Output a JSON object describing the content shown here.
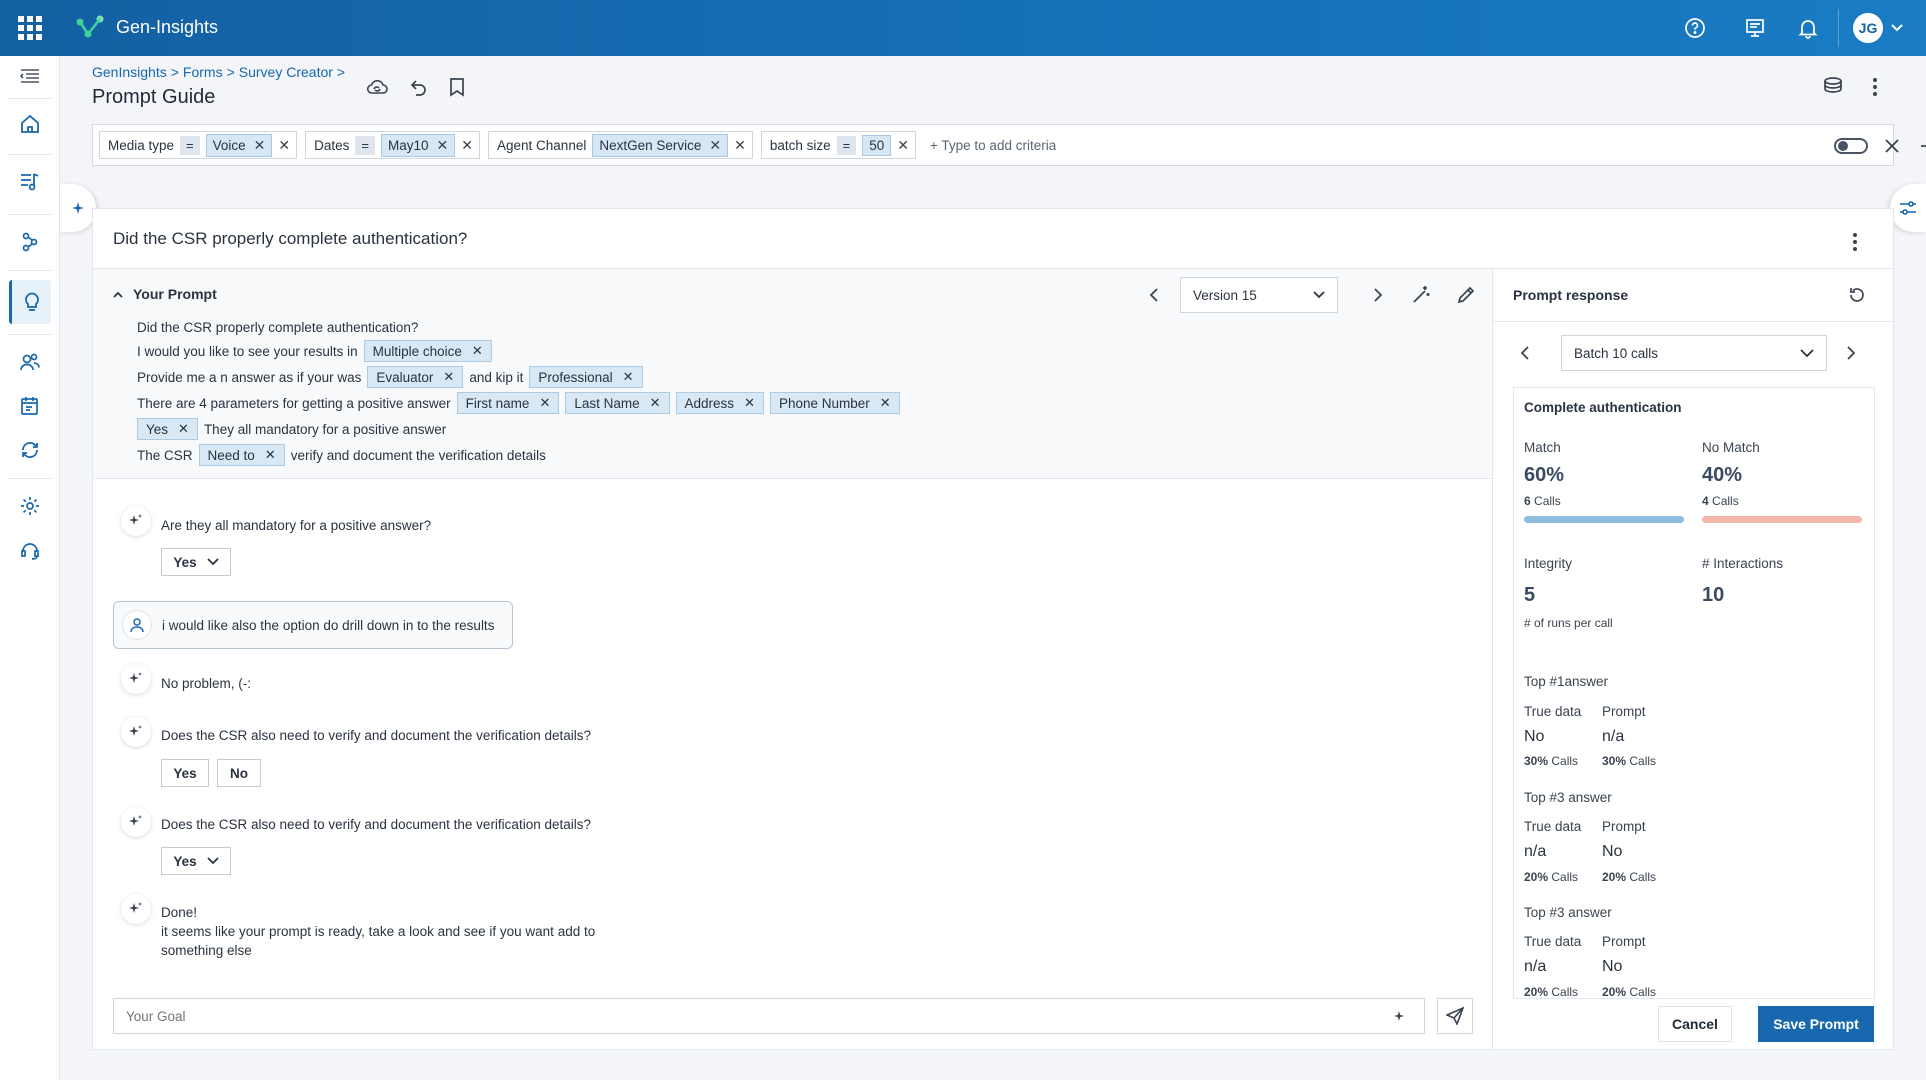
{
  "app": {
    "brand": "Gen-Insights",
    "avatar": "JG"
  },
  "breadcrumb": [
    "GenInsights",
    "Forms",
    "Survey Creator"
  ],
  "page_title": "Prompt Guide",
  "filters": [
    {
      "name": "Media type",
      "op": "=",
      "value": "Voice"
    },
    {
      "name": "Dates",
      "op": "=",
      "value": "May10"
    },
    {
      "name": "Agent Channel",
      "op": "",
      "value": "NextGen Service"
    },
    {
      "name": "batch size",
      "op": "=",
      "value": "50"
    }
  ],
  "add_criteria": "+ Type to add criteria",
  "question_title": "Did the CSR properly complete authentication?",
  "prompt": {
    "label": "Your Prompt",
    "version": "Version 15",
    "line1": "Did the CSR properly complete authentication?",
    "line2a": "I  would you like to see your results in",
    "tag_multiple": "Multiple choice",
    "line3a": "Provide me a n answer as if your was",
    "tag_evaluator": "Evaluator",
    "line3b": "and kip it",
    "tag_professional": "Professional",
    "line4a": "There are 4 parameters for getting a positive answer",
    "tag_first": "First name",
    "tag_last": "Last Name",
    "tag_address": "Address",
    "tag_phone": "Phone Number",
    "tag_yes": "Yes",
    "line5b": "They all mandatory for a positive answer",
    "line6a": "The CSR",
    "tag_needto": "Need to",
    "line6b": "verify and document the verification details"
  },
  "chat": {
    "q1": "Are they all mandatory for a positive answer?",
    "q1_select": "Yes",
    "user_msg": "i would like also the option do drill down in to the results",
    "ai_reply": "No problem, (-:",
    "q2": "Does the CSR also need to verify and document the verification details?",
    "yes": "Yes",
    "no": "No",
    "q3": "Does the CSR also need to verify and document the verification details?",
    "q3_select": "Yes",
    "done_title": "Done!",
    "done_line1": "it seems like your prompt is ready, take a look and see if you want add to",
    "done_line2": "something else",
    "goal_placeholder": "Your Goal"
  },
  "response": {
    "title": "Prompt response",
    "batch": "Batch 10 calls",
    "section": "Complete authentication",
    "match_label": "Match",
    "match_pct": "60%",
    "match_calls_n": "6",
    "nomatch_label": "No Match",
    "nomatch_pct": "40%",
    "nomatch_calls_n": "4",
    "calls": "Calls",
    "match_fraction": 0.6,
    "integrity_label": "Integrity",
    "integrity_val": "5",
    "integrity_sub": "# of runs per call",
    "interactions_label": "# Interactions",
    "interactions_val": "10",
    "true_data": "True data",
    "prompt_col": "Prompt",
    "top1": {
      "title": "Top #1answer",
      "true_val": "No",
      "prompt_val": "n/a",
      "true_pct": "30%",
      "prompt_pct": "30%"
    },
    "top2": {
      "title": "Top #3 answer",
      "true_val": "n/a",
      "prompt_val": "No",
      "true_pct": "20%",
      "prompt_pct": "20%"
    },
    "top3": {
      "title": "Top #3 answer",
      "true_val": "n/a",
      "prompt_val": "No",
      "true_pct": "20%",
      "prompt_pct": "20%"
    }
  },
  "actions": {
    "cancel": "Cancel",
    "save": "Save Prompt"
  },
  "colors": {
    "primary": "#1768ae",
    "match_bar": "#8fbde0",
    "nomatch_bar": "#f2b7a8"
  }
}
